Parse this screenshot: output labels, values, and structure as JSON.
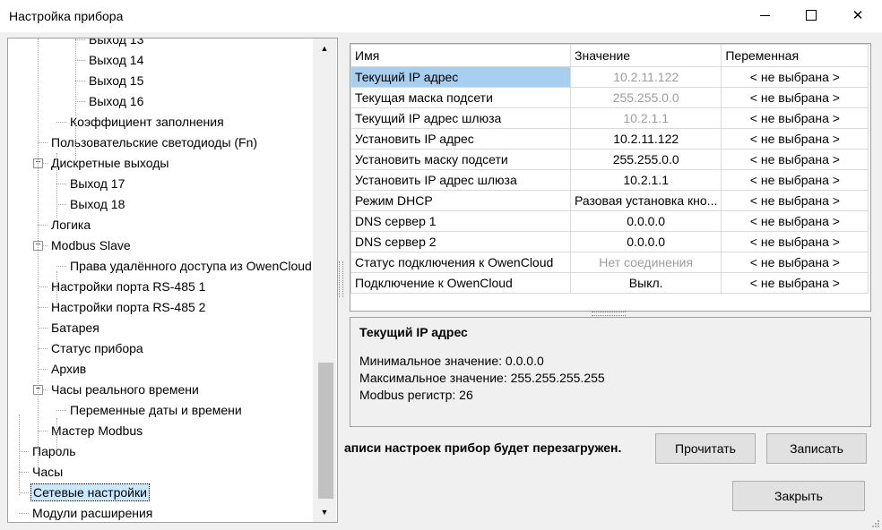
{
  "window": {
    "title": "Настройка прибора",
    "controls": {
      "minimize": "minimize-icon",
      "maximize": "maximize-icon",
      "close": "✕"
    }
  },
  "tree": {
    "items": [
      {
        "label": "Выход 13",
        "level": 4
      },
      {
        "label": "Выход 14",
        "level": 4
      },
      {
        "label": "Выход 15",
        "level": 4
      },
      {
        "label": "Выход 16",
        "level": 4
      },
      {
        "label": "Коэффициент заполнения",
        "level": 3
      },
      {
        "label": "Пользовательские светодиоды (Fn)",
        "level": 2
      },
      {
        "label": "Дискретные выходы",
        "level": 2,
        "expanded": true
      },
      {
        "label": "Выход 17",
        "level": 3
      },
      {
        "label": "Выход 18",
        "level": 3
      },
      {
        "label": "Логика",
        "level": 2
      },
      {
        "label": "Modbus Slave",
        "level": 2,
        "expanded": true
      },
      {
        "label": "Права удалённого доступа из OwenCloud",
        "level": 3
      },
      {
        "label": "Настройки порта RS-485 1",
        "level": 2
      },
      {
        "label": "Настройки порта RS-485 2",
        "level": 2
      },
      {
        "label": "Батарея",
        "level": 2
      },
      {
        "label": "Статус прибора",
        "level": 2
      },
      {
        "label": "Архив",
        "level": 2
      },
      {
        "label": "Часы реального времени",
        "level": 2,
        "expanded": true
      },
      {
        "label": "Переменные даты и времени",
        "level": 3
      },
      {
        "label": "Мастер Modbus",
        "level": 2
      },
      {
        "label": "Пароль",
        "level": 1
      },
      {
        "label": "Часы",
        "level": 1
      },
      {
        "label": "Сетевые настройки",
        "level": 1,
        "selected": true
      },
      {
        "label": "Модули расширения",
        "level": 1
      }
    ],
    "expander_symbol": "−",
    "scroll_up": "▲",
    "scroll_down": "▼",
    "scroll_position": 0.88
  },
  "grid": {
    "headers": [
      "Имя",
      "Значение",
      "Переменная"
    ],
    "rows": [
      {
        "name": "Текущий IP адрес",
        "value": "10.2.11.122",
        "var": "< не выбрана >",
        "dim": true,
        "selected": true
      },
      {
        "name": "Текущая маска подсети",
        "value": "255.255.0.0",
        "var": "< не выбрана >",
        "dim": true
      },
      {
        "name": "Текущий IP адрес шлюза",
        "value": "10.2.1.1",
        "var": "< не выбрана >",
        "dim": true
      },
      {
        "name": "Установить IP адрес",
        "value": "10.2.11.122",
        "var": "< не выбрана >"
      },
      {
        "name": "Установить маску подсети",
        "value": "255.255.0.0",
        "var": "< не выбрана >"
      },
      {
        "name": "Установить IP адрес шлюза",
        "value": "10.2.1.1",
        "var": "< не выбрана >"
      },
      {
        "name": "Режим DHCP",
        "value": "Разовая установка кно...",
        "var": "< не выбрана >"
      },
      {
        "name": "DNS сервер 1",
        "value": "0.0.0.0",
        "var": "< не выбрана >"
      },
      {
        "name": "DNS сервер 2",
        "value": "0.0.0.0",
        "var": "< не выбрана >"
      },
      {
        "name": "Статус подключения к OwenCloud",
        "value": "Нет соединения",
        "var": "< не выбрана >",
        "dim": true
      },
      {
        "name": "Подключение к OwenCloud",
        "value": "Выкл.",
        "var": "< не выбрана >"
      }
    ]
  },
  "info": {
    "heading": "Текущий IP адрес",
    "min": "Минимальное значение: 0.0.0.0",
    "max": "Максимальное значение: 255.255.255.255",
    "register": "Modbus регистр: 26"
  },
  "warning": "аписи настроек прибор будет перезагружен.",
  "buttons": {
    "read": "Прочитать",
    "write": "Записать",
    "close": "Закрыть"
  }
}
